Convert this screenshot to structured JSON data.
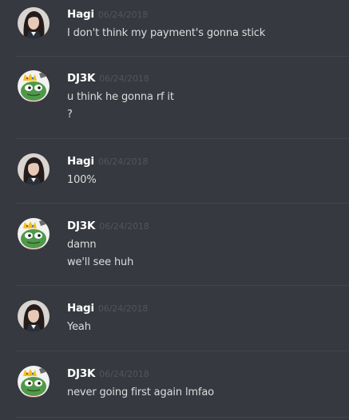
{
  "messages": [
    {
      "author": "Hagi",
      "timestamp": "06/24/2018",
      "lines": [
        "I don't think my payment's gonna stick"
      ]
    },
    {
      "author": "DJ3K",
      "timestamp": "06/24/2018",
      "lines": [
        "u think he gonna rf it",
        "?"
      ]
    },
    {
      "author": "Hagi",
      "timestamp": "06/24/2018",
      "lines": [
        "100%"
      ]
    },
    {
      "author": "DJ3K",
      "timestamp": "06/24/2018",
      "lines": [
        "damn",
        "we'll see huh"
      ]
    },
    {
      "author": "Hagi",
      "timestamp": "06/24/2018",
      "lines": [
        "Yeah"
      ]
    },
    {
      "author": "DJ3K",
      "timestamp": "06/24/2018",
      "lines": [
        "never going first again lmfao"
      ]
    }
  ],
  "avatars": {
    "Hagi": "girl-portrait-avatar",
    "DJ3K": "pepe-king-avatar"
  },
  "colors": {
    "background": "#36393f",
    "divider": "#42454a",
    "username": "#ffffff",
    "timestamp": "#52555b",
    "text": "#dcddde"
  }
}
